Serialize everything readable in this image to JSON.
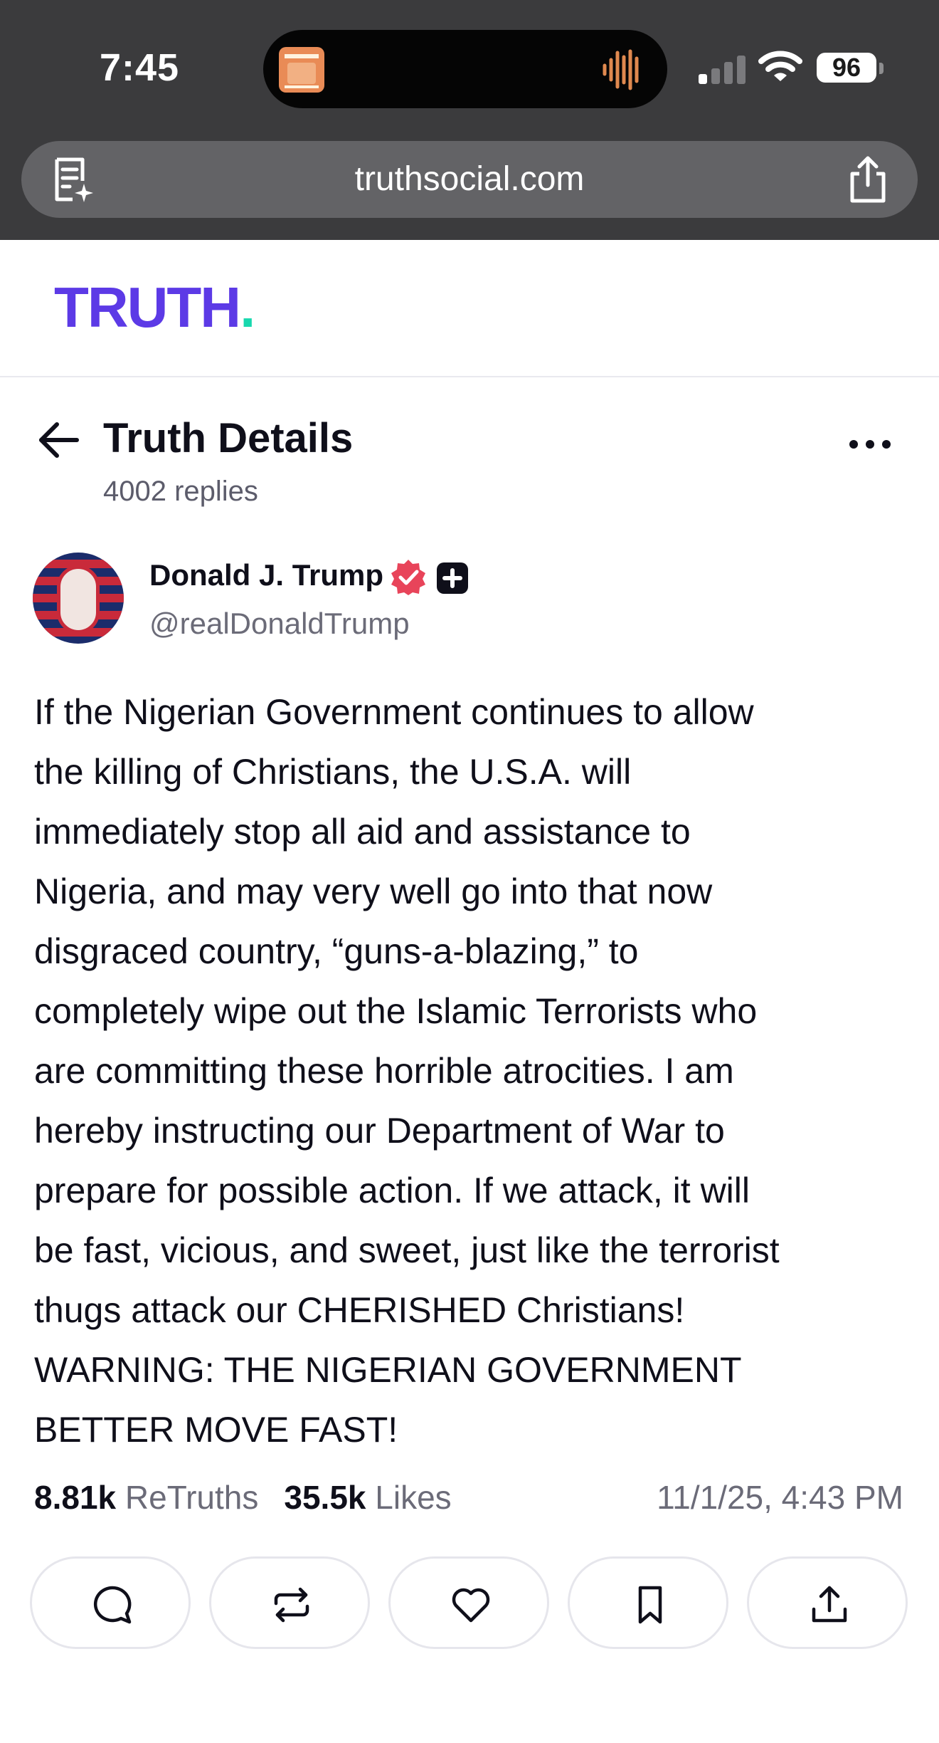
{
  "status_bar": {
    "time": "7:45",
    "battery": "96"
  },
  "browser": {
    "url": "truthsocial.com"
  },
  "header": {
    "logo_text": "TRUTH",
    "logo_dot": ".",
    "logo_color": "#5c3ae6",
    "logo_dot_color": "#18d8ae"
  },
  "page": {
    "title": "Truth Details",
    "replies": "4002 replies"
  },
  "post": {
    "author_name": "Donald J. Trump",
    "handle": "@realDonaldTrump",
    "body_lines": [
      "If the Nigerian Government continues to allow",
      "the killing of Christians, the U.S.A. will",
      "immediately stop all aid and assistance to",
      "Nigeria, and may very well go into that now",
      "disgraced country, “guns-a-blazing,” to",
      "completely wipe out the Islamic Terrorists who",
      "are committing these horrible atrocities. I am",
      "hereby instructing our Department of War to",
      "prepare for possible action. If we attack, it will",
      "be fast, vicious, and sweet, just like the terrorist",
      "thugs attack our CHERISHED Christians!",
      "WARNING: THE NIGERIAN GOVERNMENT",
      "BETTER MOVE FAST!"
    ],
    "retruths_count": "8.81k",
    "retruths_label": "ReTruths",
    "likes_count": "35.5k",
    "likes_label": "Likes",
    "timestamp": "11/1/25, 4:43 PM"
  },
  "actions": [
    "reply-icon",
    "retruth-icon",
    "like-icon",
    "bookmark-icon",
    "share-icon"
  ],
  "colors": {
    "verified": "#e8445a",
    "accent": "#5c3ae6"
  }
}
